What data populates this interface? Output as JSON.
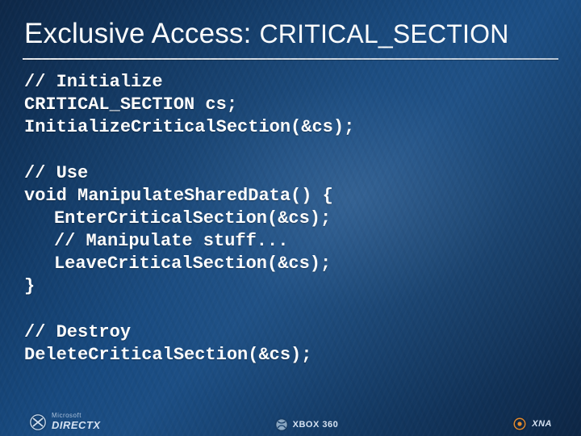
{
  "title": {
    "prefix": "Exclusive Access: ",
    "keyword": "CRITICAL_SECTION"
  },
  "code": {
    "c_init": "// Initialize",
    "l_decl": "CRITICAL_SECTION cs;",
    "l_init": "InitializeCriticalSection(&cs);",
    "c_use": "// Use",
    "l_fn_open": "void ManipulateSharedData() {",
    "l_enter": "EnterCriticalSection(&cs);",
    "c_manip": "// Manipulate stuff...",
    "l_leave": "LeaveCriticalSection(&cs);",
    "l_fn_close": "}",
    "c_destroy": "// Destroy",
    "l_delete": "DeleteCriticalSection(&cs);"
  },
  "footer": {
    "left_sub": "Microsoft",
    "left_brand": "DIRECTX",
    "center": "XBOX 360",
    "right": "XNA"
  }
}
